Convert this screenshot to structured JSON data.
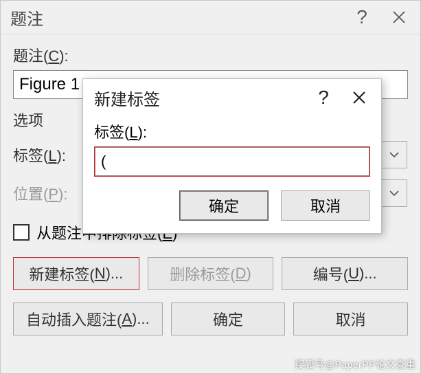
{
  "parent_dialog": {
    "title": "题注",
    "caption_label": "题注(C):",
    "caption_value": "Figure 1",
    "options_heading": "选项",
    "label_row_label": "标签(L):",
    "position_row_label": "位置(P):",
    "exclude_checkbox": "从题注中排除标签(E)",
    "new_label_btn": "新建标签(N)...",
    "delete_label_btn": "删除标签(D)",
    "numbering_btn": "编号(U)...",
    "auto_caption_btn": "自动插入题注(A)...",
    "ok_btn": "确定",
    "cancel_btn": "取消"
  },
  "child_dialog": {
    "title": "新建标签",
    "label_label": "标签(L):",
    "input_value": "(",
    "ok_btn": "确定",
    "cancel_btn": "取消"
  },
  "watermark": "搜狐号@PaperPP论文查重"
}
